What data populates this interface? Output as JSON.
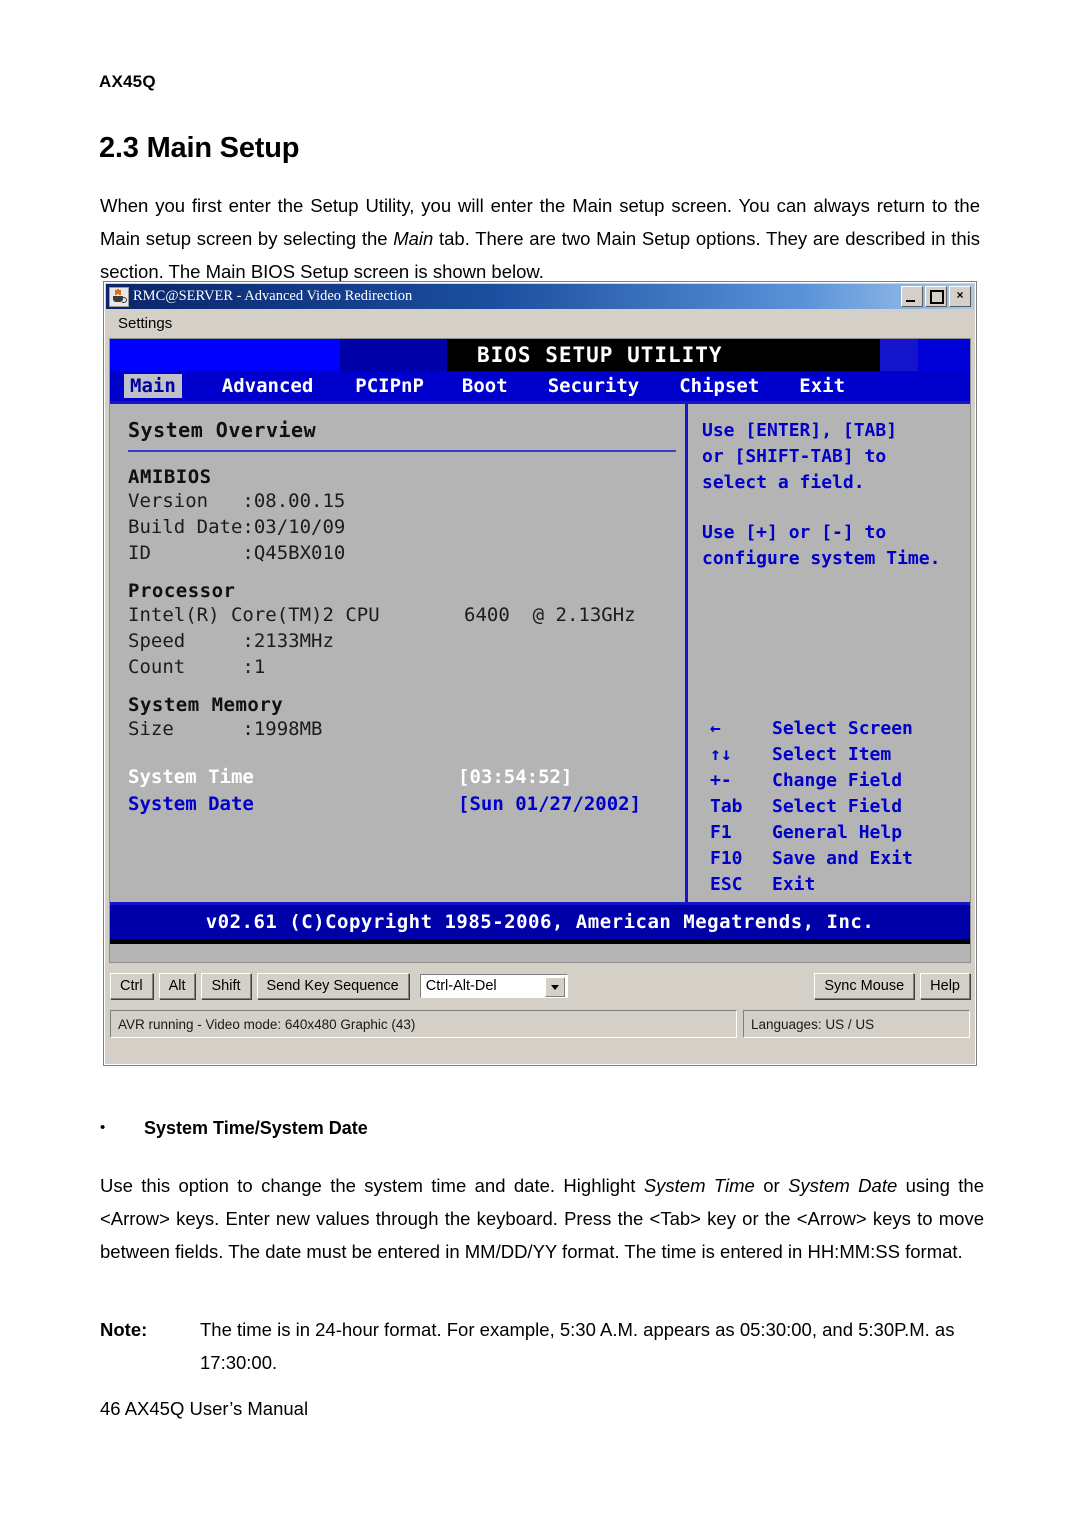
{
  "document": {
    "running_head": "AX45Q",
    "section_title": "2.3 Main Setup",
    "intro_paragraph": "When you first enter the Setup Utility, you will enter the Main setup screen. You can always return to the Main setup screen by selecting the Main tab. There are two Main Setup options. They are described in this section. The Main BIOS Setup screen is shown below.",
    "bullet_heading": "System Time/System Date",
    "bullet_marker": "•",
    "body_paragraph": "Use this option to change the system time and date. Highlight System Time or System Date using the <Arrow> keys. Enter new values through the keyboard. Press the <Tab> key or the <Arrow> keys to move between fields. The date must be entered in MM/DD/YY format. The time is entered in HH:MM:SS format.",
    "note_label": "Note:",
    "note_text": "The time is in 24-hour format. For example, 5:30 A.M. appears as 05:30:00, and 5:30P.M. as 17:30:00.",
    "footer": "46 AX45Q User’s Manual"
  },
  "avr_window": {
    "title": "RMC@SERVER - Advanced Video Redirection",
    "icon": "java-coffee-cup-icon",
    "window_buttons": {
      "minimize": "minimize-icon",
      "maximize": "maximize-icon",
      "close": "×"
    },
    "menu": {
      "items": [
        "Settings"
      ]
    },
    "toolbar": {
      "ctrl": "Ctrl",
      "alt": "Alt",
      "shift": "Shift",
      "send_key_sequence": "Send Key Sequence",
      "key_sequence_selected": "Ctrl-Alt-Del",
      "key_sequence_options": [
        "Ctrl-Alt-Del"
      ],
      "sync_mouse": "Sync Mouse",
      "help": "Help"
    },
    "status": {
      "left": "AVR running - Video mode: 640x480 Graphic (43)",
      "right": "Languages: US / US"
    }
  },
  "bios": {
    "banner": "BIOS SETUP UTILITY",
    "tabs": [
      {
        "label": "Main",
        "active": true
      },
      {
        "label": "Advanced",
        "active": false
      },
      {
        "label": "PCIPnP",
        "active": false
      },
      {
        "label": "Boot",
        "active": false
      },
      {
        "label": "Security",
        "active": false
      },
      {
        "label": "Chipset",
        "active": false
      },
      {
        "label": "Exit",
        "active": false
      }
    ],
    "left_panel": {
      "title": "System Overview",
      "amibios": {
        "heading": "AMIBIOS",
        "rows": [
          {
            "key": "Version   ",
            "value": ":08.00.15"
          },
          {
            "key": "Build Date",
            "value": ":03/10/09"
          },
          {
            "key": "ID        ",
            "value": ":Q45BX010"
          }
        ]
      },
      "processor": {
        "heading": "Processor",
        "model_left": "Intel(R) Core(TM)2 CPU",
        "model_right": "6400  @ 2.13GHz",
        "rows": [
          {
            "key": "Speed     ",
            "value": ":2133MHz"
          },
          {
            "key": "Count     ",
            "value": ":1"
          }
        ]
      },
      "system_memory": {
        "heading": "System Memory",
        "rows": [
          {
            "key": "Size      ",
            "value": ":1998MB"
          }
        ]
      },
      "system_time": {
        "label": "System Time",
        "value": "[03:54:52]",
        "selected": true
      },
      "system_date": {
        "label": "System Date",
        "value": "[Sun 01/27/2002]",
        "selected": false
      }
    },
    "right_panel": {
      "help_1": "Use [ENTER], [TAB]\nor [SHIFT-TAB] to\nselect a field.",
      "help_2": "Use [+] or [-] to\nconfigure system Time.",
      "keys": [
        {
          "key": "←",
          "action": "Select Screen"
        },
        {
          "key": "↑↓",
          "action": "Select Item"
        },
        {
          "key": "+-",
          "action": "Change Field"
        },
        {
          "key": "Tab",
          "action": "Select Field"
        },
        {
          "key": "F1",
          "action": "General Help"
        },
        {
          "key": "F10",
          "action": "Save and Exit"
        },
        {
          "key": "ESC",
          "action": "Exit"
        }
      ]
    },
    "footer": "v02.61 (C)Copyright 1985-2006, American Megatrends, Inc."
  },
  "colors": {
    "bios_blue": "#0000cd",
    "bios_gray": "#b4b4b4",
    "bios_accent": "#1616c8",
    "titlebar_blue": "#0a246a",
    "window_face": "#d4d0c8"
  }
}
